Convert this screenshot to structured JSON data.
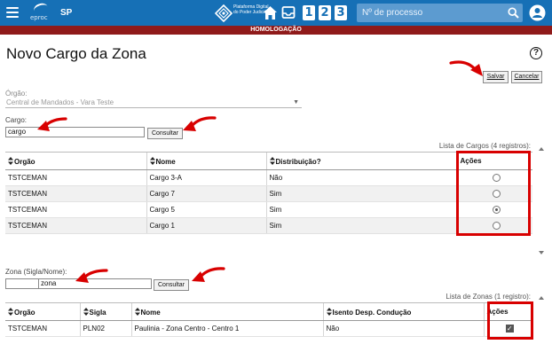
{
  "header": {
    "brand": "eproc",
    "state": "SP",
    "platform_text": "Plataforma Digital do Poder Judiciário",
    "quick_buttons": [
      "1",
      "2",
      "3"
    ],
    "search_placeholder": "Nº de processo",
    "color": "#1670b6"
  },
  "environment_banner": "HOMOLOGAÇÃO",
  "page": {
    "title": "Novo Cargo da Zona",
    "save_label": "Salvar",
    "cancel_label": "Cancelar"
  },
  "form": {
    "orgao_label": "Órgão:",
    "orgao_value": "Central de Mandados - Vara Teste",
    "cargo_label": "Cargo:",
    "cargo_value": "cargo",
    "consultar_label": "Consultar",
    "zona_label": "Zona (Sigla/Nome):",
    "zona_sigla_value": "",
    "zona_nome_value": "zona"
  },
  "cargos": {
    "caption": "Lista de Cargos (4 registros):",
    "columns": [
      "Orgão",
      "Nome",
      "Distribuição?",
      "Ações"
    ],
    "rows": [
      {
        "orgao": "TSTCEMAN",
        "nome": "Cargo 3-A",
        "distribuicao": "Não",
        "selected": false
      },
      {
        "orgao": "TSTCEMAN",
        "nome": "Cargo 7",
        "distribuicao": "Sim",
        "selected": false
      },
      {
        "orgao": "TSTCEMAN",
        "nome": "Cargo 5",
        "distribuicao": "Sim",
        "selected": true
      },
      {
        "orgao": "TSTCEMAN",
        "nome": "Cargo 1",
        "distribuicao": "Sim",
        "selected": false
      }
    ]
  },
  "zonas": {
    "caption": "Lista de Zonas (1 registro):",
    "columns": [
      "Orgão",
      "Sigla",
      "Nome",
      "Isento Desp. Condução",
      "Ações"
    ],
    "rows": [
      {
        "orgao": "TSTCEMAN",
        "sigla": "PLN02",
        "nome": "Paulinia - Zona Centro - Centro 1",
        "isento": "Não",
        "checked": true
      }
    ]
  },
  "icons": {
    "menu": "menu-icon",
    "home": "home-icon",
    "inbox": "inbox-icon",
    "search": "search-icon",
    "user": "user-icon",
    "help": "help-icon",
    "sort": "sort-icon"
  },
  "annotation_color": "#d80000"
}
